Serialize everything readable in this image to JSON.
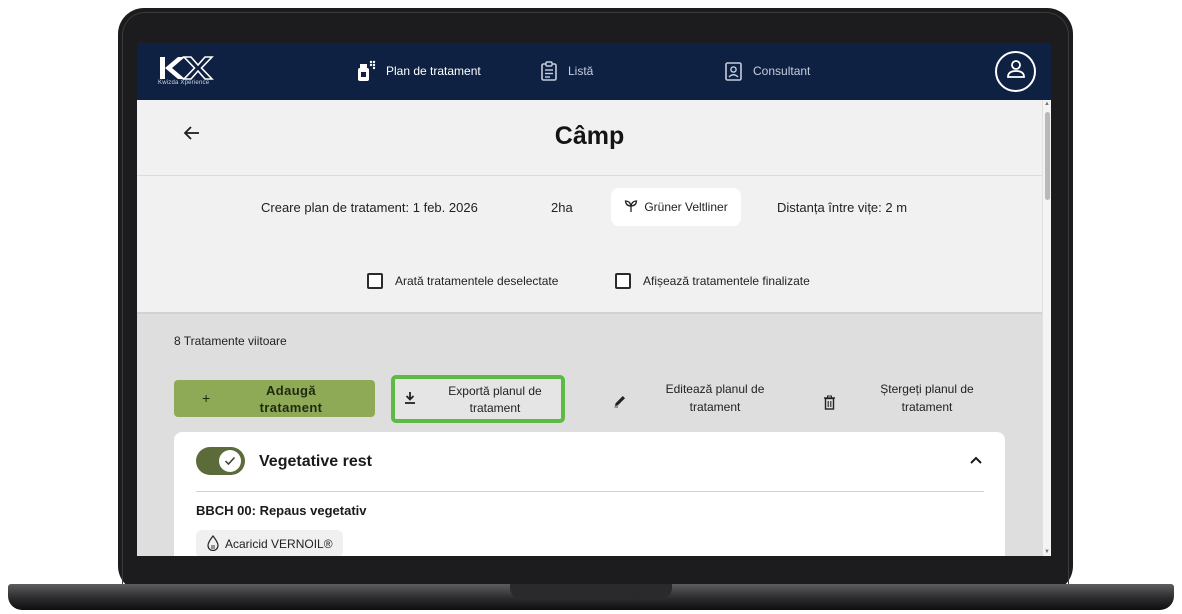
{
  "nav": {
    "logo_subtitle": "Kwizda Xperience",
    "items": [
      {
        "label": "Plan de tratament",
        "icon": "sprayer-icon",
        "active": true
      },
      {
        "label": "Listă",
        "icon": "clipboard-icon",
        "active": false
      },
      {
        "label": "Consultant",
        "icon": "contact-card-icon",
        "active": false
      }
    ],
    "profile_icon": "user-icon"
  },
  "header": {
    "title": "Câmp",
    "back_icon": "arrow-left-icon"
  },
  "info": {
    "created": "Creare plan de tratament: 1 feb. 2026",
    "area": "2ha",
    "variety": "Grüner Veltliner",
    "variety_icon": "sprout-icon",
    "spacing": "Distanța între vițe: 2 m"
  },
  "filters": {
    "show_deselected": {
      "label": "Arată tratamentele deselectate",
      "checked": false
    },
    "show_finished": {
      "label": "Afișează tratamentele finalizate",
      "checked": false
    }
  },
  "treatments": {
    "count_label": "8 Tratamente viitoare",
    "add_button": {
      "line1": "Adaugă",
      "line2": "tratament"
    },
    "export_button": {
      "line1": "Exportă planul de",
      "line2": "tratament"
    },
    "edit_button": {
      "line1": "Editează planul de",
      "line2": "tratament"
    },
    "delete_button": {
      "line1": "Ștergeți planul de",
      "line2": "tratament"
    }
  },
  "card": {
    "title": "Vegetative rest",
    "enabled": true,
    "stage": "BBCH 00: Repaus vegetativ",
    "product": "Acaricid VERNOIL®",
    "product_icon": "droplet-icon"
  },
  "colors": {
    "navbar": "#0e2142",
    "accent_green": "#8faa57",
    "highlight_green": "#5dbb45",
    "toggle_green": "#5c6b3a"
  }
}
